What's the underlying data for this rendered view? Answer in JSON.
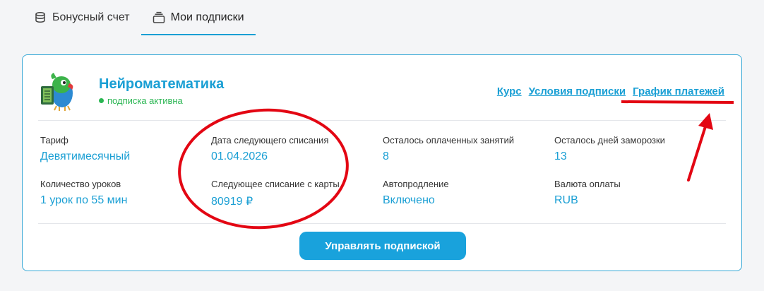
{
  "tabs": [
    {
      "label": "Бонусный счет",
      "icon": "coins-icon",
      "active": false
    },
    {
      "label": "Мои подписки",
      "icon": "stack-icon",
      "active": true
    }
  ],
  "subscription": {
    "title": "Нейроматематика",
    "status": "подписка активна",
    "links": {
      "course": "Курс",
      "terms": "Условия подписки",
      "schedule": "График платежей"
    },
    "fields": {
      "tariff_label": "Тариф",
      "tariff_value": "Девятимесячный",
      "next_charge_date_label": "Дата следующего списания",
      "next_charge_date_value": "01.04.2026",
      "paid_lessons_label": "Осталось оплаченных занятий",
      "paid_lessons_value": "8",
      "freeze_days_label": "Осталось дней заморозки",
      "freeze_days_value": "13",
      "lessons_count_label": "Количество уроков",
      "lessons_count_value": "1 урок по 55 мин",
      "next_charge_amount_label": "Следующее списание с карты",
      "next_charge_amount_value": "80919 ₽",
      "autorenew_label": "Автопродление",
      "autorenew_value": "Включено",
      "currency_label": "Валюта оплаты",
      "currency_value": "RUB"
    },
    "manage_button": "Управлять подпиской"
  },
  "colors": {
    "accent": "#1a9fd4",
    "status_active": "#2bb653",
    "annotation": "#e30613"
  }
}
